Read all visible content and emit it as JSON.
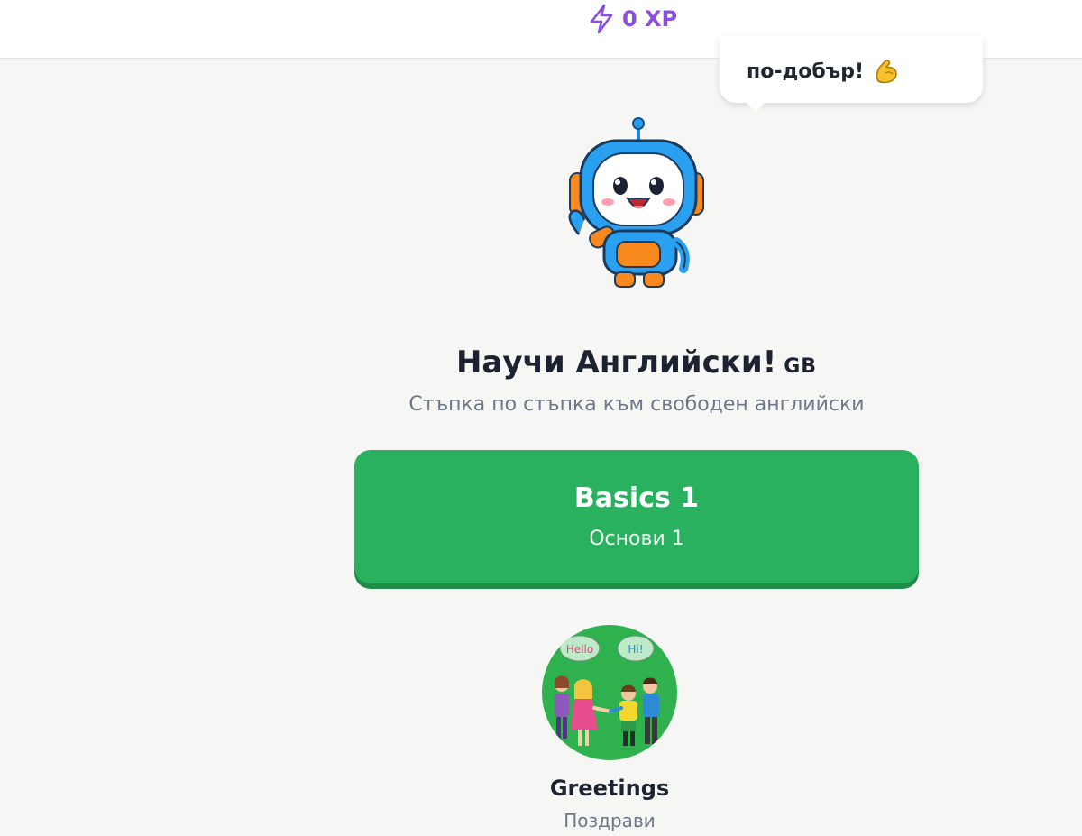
{
  "header": {
    "xp_label": "0 XP",
    "xp_icon": "lightning-bolt-icon"
  },
  "mascot": {
    "speech_text": "по-добър!",
    "speech_emoji": "flexed-biceps-icon",
    "image": "robot-mascot-waving"
  },
  "course": {
    "title": "Научи Английски!",
    "flag_text": "GB",
    "subtitle": "Стъпка по стъпка към свободен английски"
  },
  "unit": {
    "title": "Basics 1",
    "subtitle": "Основи 1"
  },
  "lessons": [
    {
      "title": "Greetings",
      "subtitle": "Поздрави",
      "bubbles": [
        "Hello",
        "Hi!"
      ]
    }
  ],
  "colors": {
    "accent_purple": "#8b4fe0",
    "unit_green": "#2ab160",
    "unit_green_shadow": "#1f8c4a",
    "background": "#f6f7f5"
  }
}
